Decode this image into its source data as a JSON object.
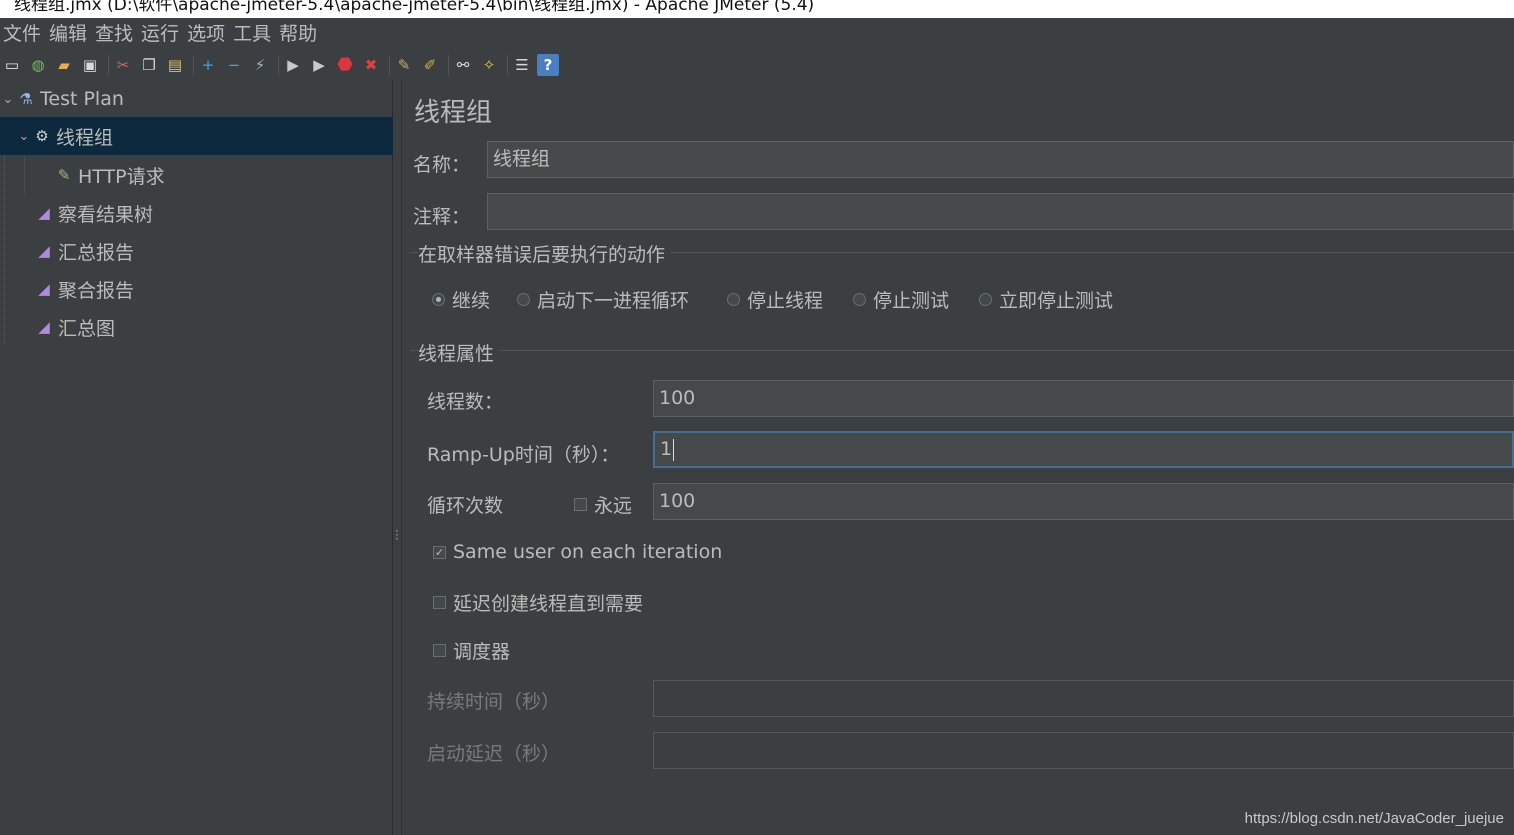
{
  "window": {
    "title": "线程组.jmx (D:\\软件\\apache-jmeter-5.4\\apache-jmeter-5.4\\bin\\线程组.jmx) - Apache JMeter (5.4)"
  },
  "menu": [
    "文件",
    "编辑",
    "查找",
    "运行",
    "选项",
    "工具",
    "帮助"
  ],
  "toolbar": {
    "buttons": [
      {
        "name": "new-icon",
        "glyph": "▭",
        "color": "#e8e8e8"
      },
      {
        "name": "templates-icon",
        "glyph": "◍",
        "color": "#6fbf5a"
      },
      {
        "name": "open-icon",
        "glyph": "▰",
        "color": "#e3b04b"
      },
      {
        "name": "save-icon",
        "glyph": "▣",
        "color": "#d8d8d8"
      },
      {
        "name": "cut-icon",
        "glyph": "✂",
        "color": "#e25c5c"
      },
      {
        "name": "copy-icon",
        "glyph": "❐",
        "color": "#d8d8d8"
      },
      {
        "name": "paste-icon",
        "glyph": "▤",
        "color": "#e3c36b"
      },
      {
        "name": "expand-icon",
        "glyph": "+",
        "color": "#4a9fe0"
      },
      {
        "name": "collapse-icon",
        "glyph": "−",
        "color": "#4a9fe0"
      },
      {
        "name": "toggle-icon",
        "glyph": "⚡",
        "color": "#9ab0c8"
      },
      {
        "name": "start-icon",
        "glyph": "▶",
        "color": "#c8c8c8"
      },
      {
        "name": "start-no-pause-icon",
        "glyph": "▶",
        "color": "#c8c8c8"
      },
      {
        "name": "stop-icon",
        "glyph": "⬣",
        "color": "#d9363e"
      },
      {
        "name": "shutdown-icon",
        "glyph": "✖",
        "color": "#e04040"
      },
      {
        "name": "clear-icon",
        "glyph": "✎",
        "color": "#c9a860"
      },
      {
        "name": "clear-all-icon",
        "glyph": "✐",
        "color": "#c9a860"
      },
      {
        "name": "search-icon",
        "glyph": "⚯",
        "color": "#d8d8d8"
      },
      {
        "name": "reset-search-icon",
        "glyph": "✧",
        "color": "#f0c030"
      },
      {
        "name": "function-helper-icon",
        "glyph": "☰",
        "color": "#d8d8d8"
      },
      {
        "name": "help-icon",
        "glyph": "?",
        "color": "#ffffff"
      }
    ]
  },
  "tree": {
    "root": "Test Plan",
    "items": [
      {
        "label": "线程组",
        "icon": "gear-icon"
      },
      {
        "label": "HTTP请求",
        "icon": "pipette-icon"
      },
      {
        "label": "察看结果树",
        "icon": "graph-icon"
      },
      {
        "label": "汇总报告",
        "icon": "graph-icon"
      },
      {
        "label": "聚合报告",
        "icon": "graph-icon"
      },
      {
        "label": "汇总图",
        "icon": "graph-icon"
      }
    ]
  },
  "form": {
    "title": "线程组",
    "name_label": "名称：",
    "name_value": "线程组",
    "comment_label": "注释：",
    "comment_value": "",
    "error_action_title": "在取样器错误后要执行的动作",
    "error_actions": [
      {
        "label": "继续",
        "selected": true
      },
      {
        "label": "启动下一进程循环",
        "selected": false
      },
      {
        "label": "停止线程",
        "selected": false
      },
      {
        "label": "停止测试",
        "selected": false
      },
      {
        "label": "立即停止测试",
        "selected": false
      }
    ],
    "thread_props_title": "线程属性",
    "threads_label": "线程数：",
    "threads_value": "100",
    "rampup_label": "Ramp-Up时间（秒）：",
    "rampup_value": "1",
    "loop_label": "循环次数",
    "forever_label": "永远",
    "forever_checked": false,
    "loop_value": "100",
    "same_user_label": "Same user on each iteration",
    "same_user_checked": true,
    "delay_create_label": "延迟创建线程直到需要",
    "delay_create_checked": false,
    "scheduler_label": "调度器",
    "scheduler_checked": false,
    "duration_label": "持续时间（秒）",
    "duration_value": "",
    "startup_delay_label": "启动延迟（秒）",
    "startup_delay_value": ""
  },
  "watermark": "https://blog.csdn.net/JavaCoder_juejue"
}
